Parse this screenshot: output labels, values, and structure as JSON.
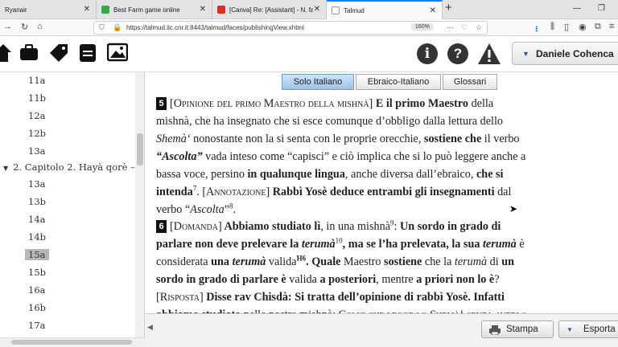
{
  "browser": {
    "tabs": [
      {
        "label": "Ryanair",
        "active": false
      },
      {
        "label": "Best Farm game online",
        "active": false
      },
      {
        "label": "[Canva] Re: [Assistant] - N. fatt...",
        "active": false
      },
      {
        "label": "Talmud",
        "active": true
      }
    ],
    "url": "https://talmud.ilc.cnr.it:8443/talmud/faces/publishingView.xhtml",
    "zoom": "160%"
  },
  "header": {
    "user_name": "Daniele Cohenca",
    "info_glyph": "i",
    "help_glyph": "?",
    "warning_glyph": "!"
  },
  "tree": {
    "nodes_before": [
      "11a",
      "11b",
      "12a",
      "12b",
      "13a"
    ],
    "chapter": "2. Capitolo 2. Hayà qorè –",
    "nodes_after": [
      "13a",
      "13b",
      "14a",
      "14b",
      "15a",
      "15b",
      "16a",
      "16b",
      "17a"
    ],
    "selected": "15a"
  },
  "view_tabs": [
    "Solo Italiano",
    "Ebraico-Italiano",
    "Glossari"
  ],
  "active_view_tab": "Solo Italiano",
  "passage_5": {
    "number": "5",
    "runs": [
      {
        "t": "[Opinione del primo Maestro della mishnà]",
        "s": "sc"
      },
      {
        "t": " E il primo Maestro",
        "s": "b"
      },
      {
        "t": " della mishnà, che ha insegnato che si esce comunque d’obbligo dalla lettura dello ",
        "s": ""
      },
      {
        "t": "Shemà‘",
        "s": "i"
      },
      {
        "t": " nonostante non la si senta con le proprie orecchie, ",
        "s": ""
      },
      {
        "t": "sostiene che",
        "s": "b"
      },
      {
        "t": " il verbo ",
        "s": ""
      },
      {
        "t": "“Ascolta”",
        "s": "bi"
      },
      {
        "t": " vada inteso come “capisci” e ciò implica che si lo può leggere anche a bassa voce, persino ",
        "s": ""
      },
      {
        "t": "in qualunque lingua",
        "s": "b"
      },
      {
        "t": ", anche diversa dall’ebraico, ",
        "s": ""
      },
      {
        "t": "che si intenda",
        "s": "b"
      },
      {
        "t": "7",
        "s": "sup"
      },
      {
        "t": ". [Annotazione]",
        "s": "sc"
      },
      {
        "t": " Rabbì Yosè deduce entrambi gli insegnamenti",
        "s": "b"
      },
      {
        "t": " dal verbo “",
        "s": ""
      },
      {
        "t": "Ascolta",
        "s": "i"
      },
      {
        "t": "”",
        "s": ""
      },
      {
        "t": "8",
        "s": "sup"
      },
      {
        "t": ".",
        "s": ""
      }
    ]
  },
  "passage_6": {
    "number": "6",
    "runs": [
      {
        "t": "[Domanda]",
        "s": "sc"
      },
      {
        "t": " Abbiamo studiato lì",
        "s": "b"
      },
      {
        "t": ", in una mishnà",
        "s": ""
      },
      {
        "t": "9",
        "s": "sup"
      },
      {
        "t": ": ",
        "s": ""
      },
      {
        "t": "Un sordo in grado di parlare non deve prelevare la ",
        "s": "b"
      },
      {
        "t": "terumà",
        "s": "bi"
      },
      {
        "t": "10",
        "s": "sup"
      },
      {
        "t": ", ma se l’ha prelevata, la sua ",
        "s": "b"
      },
      {
        "t": "terumà",
        "s": "bi"
      },
      {
        "t": " è considerata ",
        "s": ""
      },
      {
        "t": "una ",
        "s": "b"
      },
      {
        "t": "terumà",
        "s": "bi"
      },
      {
        "t": " valida",
        "s": ""
      },
      {
        "t": "H6",
        "s": "supb"
      },
      {
        "t": ". Quale",
        "s": "b"
      },
      {
        "t": " Maestro ",
        "s": ""
      },
      {
        "t": "sostiene",
        "s": "b"
      },
      {
        "t": " che la ",
        "s": ""
      },
      {
        "t": "terumà",
        "s": "i"
      },
      {
        "t": " di ",
        "s": ""
      },
      {
        "t": "un sordo in grado di parlare è",
        "s": "b"
      },
      {
        "t": " valida ",
        "s": ""
      },
      {
        "t": "a posteriori",
        "s": "b"
      },
      {
        "t": ", mentre ",
        "s": ""
      },
      {
        "t": "a priori non lo è",
        "s": "b"
      },
      {
        "t": "? ",
        "s": ""
      },
      {
        "t": "[Risposta]",
        "s": "sc"
      },
      {
        "t": " Disse rav Chisdà: Si tratta dell’opinione di rabbì Yosè. Infatti abbiamo studiato",
        "s": "b"
      },
      {
        "t": " nella nostra mishnà: ",
        "s": ""
      },
      {
        "t": "Colui che legge lo Shemà‘ senza averlo sentito con le proprie orecchie è uscito",
        "s": "sc"
      }
    ]
  },
  "toolbar": {
    "print_label": "Stampa",
    "export_label": "Esporta"
  }
}
